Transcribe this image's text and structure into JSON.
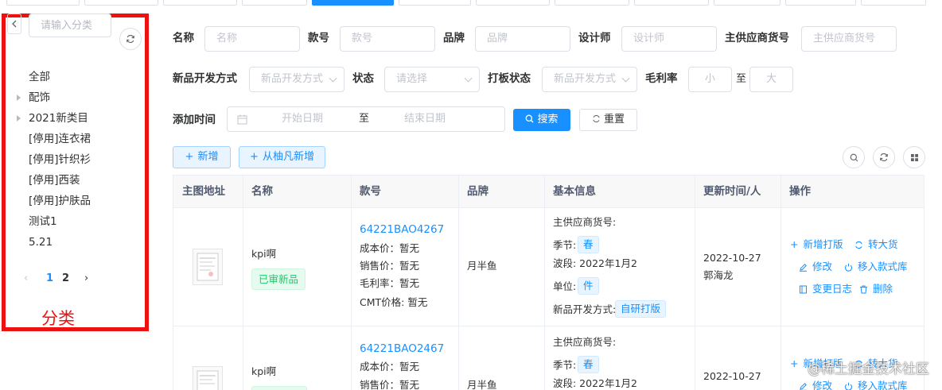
{
  "sidebar": {
    "search_placeholder": "请输入分类",
    "tree": [
      {
        "label": "全部",
        "expandable": false
      },
      {
        "label": "配饰",
        "expandable": true
      },
      {
        "label": "2021新类目",
        "expandable": true
      },
      {
        "label": "[停用]连衣裙",
        "expandable": false
      },
      {
        "label": "[停用]针织衫",
        "expandable": false
      },
      {
        "label": "[停用]西装",
        "expandable": false
      },
      {
        "label": "[停用]护肤品",
        "expandable": false
      },
      {
        "label": "测试1",
        "expandable": false
      },
      {
        "label": "5.21",
        "expandable": false
      }
    ],
    "pager": {
      "prev": "‹",
      "page1": "1",
      "page2": "2",
      "next": "›"
    },
    "annotation": "分类"
  },
  "filters": {
    "name_label": "名称",
    "name_placeholder": "名称",
    "style_no_label": "款号",
    "style_no_placeholder": "款号",
    "brand_label": "品牌",
    "brand_placeholder": "品牌",
    "designer_label": "设计师",
    "designer_placeholder": "设计师",
    "supplier_no_label": "主供应商货号",
    "supplier_no_placeholder": "主供应商货号",
    "dev_mode_label": "新品开发方式",
    "dev_mode_placeholder": "新品开发方式",
    "status_label": "状态",
    "status_placeholder": "请选择",
    "proof_status_label": "打板状态",
    "proof_status_placeholder": "新品开发方式",
    "margin_label": "毛利率",
    "margin_min_placeholder": "小",
    "margin_to": "至",
    "margin_max_placeholder": "大",
    "add_time_label": "添加时间",
    "start_date_placeholder": "开始日期",
    "date_to": "至",
    "end_date_placeholder": "结束日期",
    "search_button": "搜索",
    "reset_button": "重置"
  },
  "toolbar": {
    "add_button": "新增",
    "add_from_button": "从柚凡新增"
  },
  "table": {
    "columns": [
      "主图地址",
      "名称",
      "款号",
      "品牌",
      "基本信息",
      "更新时间/人",
      "操作"
    ],
    "rows": [
      {
        "name": "kpi啊",
        "status_tag": "已审新品",
        "style_no": "64221BAO4267",
        "cost": "成本价：暂无",
        "sale": "销售价：暂无",
        "margin": "毛利率：暂无",
        "cmt": "CMT价格: 暂无",
        "brand": "月半鱼",
        "supplier_no": "主供应商货号:",
        "season_label": "季节:",
        "season": "春",
        "wave": "波段: 2022年1月2",
        "unit_label": "单位:",
        "unit": "件",
        "dev_label": "新品开发方式:",
        "dev": "自研打版",
        "date": "2022-10-27",
        "person": "郭海龙",
        "actions": {
          "add_proof": "新增打版",
          "to_bulk": "转大货",
          "edit": "修改",
          "move_lib": "移入款式库",
          "log": "变更日志",
          "delete": "删除"
        }
      },
      {
        "name": "kpi啊",
        "style_no": "64221BAO2467",
        "cost": "成本价：暂无",
        "sale": "销售价：暂无",
        "brand": "月半鱼",
        "supplier_no": "主供应商货号:",
        "season_label": "季节:",
        "season": "春",
        "wave": "波段: 2022年1月2",
        "date": "2022-10-27",
        "actions": {
          "add_proof": "新增打版",
          "to_bulk": "转大货",
          "edit": "修改",
          "move_lib": "移入款式库"
        }
      }
    ]
  },
  "watermark": "@稀土掘金技术社区",
  "colors": {
    "primary": "#1890ff",
    "annotation_red": "#ee1111",
    "success": "#13ce66"
  }
}
